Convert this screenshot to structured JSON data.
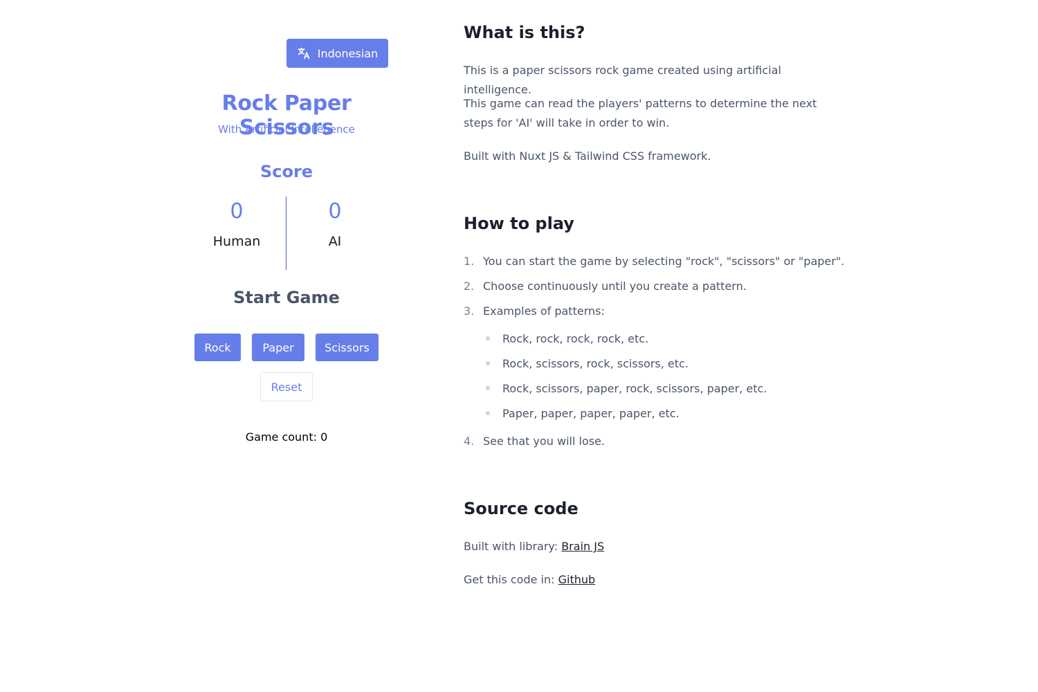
{
  "language_button": {
    "label": "Indonesian",
    "icon": "translate-icon"
  },
  "game": {
    "title": "Rock Paper Scissors",
    "subtitle": "With Artificial Intellegence",
    "score_title": "Score",
    "human_score": "0",
    "ai_score": "0",
    "human_label": "Human",
    "ai_label": "AI",
    "start_title": "Start Game",
    "buttons": {
      "rock": "Rock",
      "paper": "Paper",
      "scissors": "Scissors",
      "reset": "Reset"
    },
    "game_count": "Game count: 0"
  },
  "about": {
    "heading": "What is this?",
    "p1": "This is a paper scissors rock game created using artificial intelligence.",
    "p2": "This game can read the players' patterns to determine the next steps for 'AI' will take in order to win.",
    "p3": "Built with Nuxt JS & Tailwind CSS framework."
  },
  "how_to_play": {
    "heading": "How to play",
    "steps": [
      {
        "num": "1.",
        "text": "You can start the game by selecting \"rock\", \"scissors\" or \"paper\"."
      },
      {
        "num": "2.",
        "text": "Choose continuously until you create a pattern."
      },
      {
        "num": "3.",
        "text": "Examples of patterns:"
      },
      {
        "num": "4.",
        "text": "See that you will lose."
      }
    ],
    "patterns": [
      "Rock, rock, rock, rock, etc.",
      "Rock, scissors, rock, scissors, etc.",
      "Rock, scissors, paper, rock, scissors, paper, etc.",
      "Paper, paper, paper, paper, etc."
    ]
  },
  "source": {
    "heading": "Source code",
    "library_prefix": "Built with library:",
    "library_link": "Brain JS",
    "code_prefix": "Get this code in:",
    "code_link": "Github"
  },
  "colors": {
    "accent": "#667eea",
    "heading": "#1a202c",
    "body_text": "#4a5568"
  }
}
